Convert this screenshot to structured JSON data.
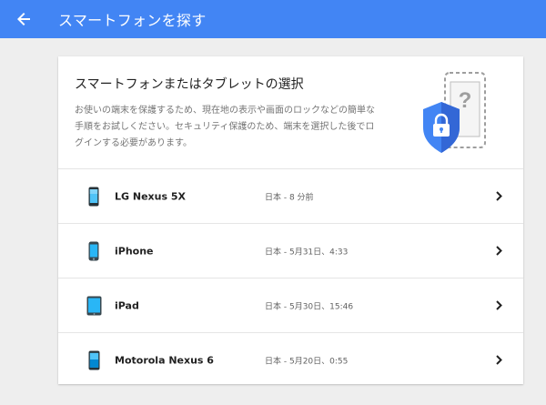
{
  "header": {
    "title": "スマートフォンを探す",
    "back_icon": "arrow-back-icon"
  },
  "card": {
    "title": "スマートフォンまたはタブレットの選択",
    "description": "お使いの端末を保護するため、現在地の表示や画面のロックなどの簡単な手順をお試しください。セキュリティ保護のため、端末を選択した後でログインする必要があります。",
    "illustration": "shield-lock-phone-icon"
  },
  "devices": [
    {
      "name": "LG Nexus 5X",
      "last_seen": "日本 - 8 分前",
      "icon": "smartphone-icon"
    },
    {
      "name": "iPhone",
      "last_seen": "日本 - 5月31日、4:33",
      "icon": "smartphone-icon"
    },
    {
      "name": "iPad",
      "last_seen": "日本 - 5月30日、15:46",
      "icon": "tablet-icon"
    },
    {
      "name": "Motorola Nexus 6",
      "last_seen": "日本 - 5月20日、0:55",
      "icon": "smartphone-icon"
    }
  ],
  "colors": {
    "appbar": "#4285f4",
    "shield": "#4285f4",
    "background": "#eeeeee"
  }
}
